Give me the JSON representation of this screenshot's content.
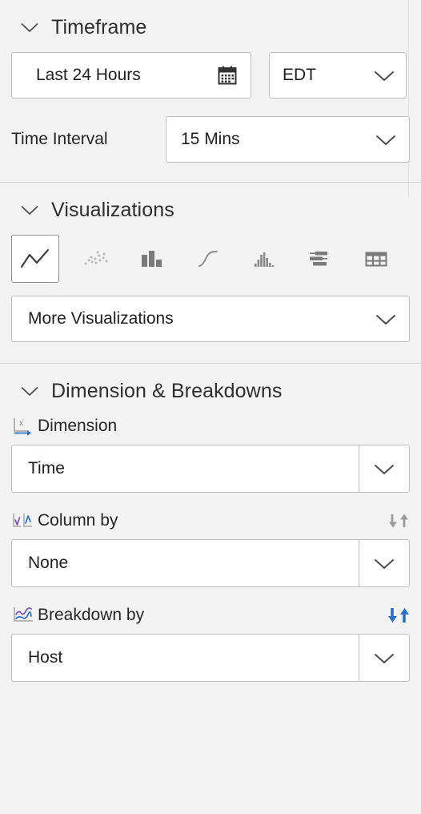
{
  "panel": {
    "accent_blue": "#2c6fc4",
    "accent_purple": "#7a52b3",
    "border_color": "#bdbdbd",
    "background": "#f3f3f3"
  },
  "timeframe": {
    "title": "Timeframe",
    "collapse_icon": "chevron-down-icon",
    "date_range": {
      "value": "Last 24 Hours",
      "icon": "calendar-icon"
    },
    "timezone": {
      "value": "EDT",
      "icon": "chevron-down-icon"
    },
    "time_interval": {
      "label": "Time Interval",
      "value": "15 Mins",
      "icon": "chevron-down-icon"
    }
  },
  "visualizations": {
    "title": "Visualizations",
    "collapse_icon": "chevron-down-icon",
    "selected": "line-chart",
    "options": [
      {
        "id": "line-chart",
        "name": "line-chart-icon",
        "selected": true
      },
      {
        "id": "scatter-plot",
        "name": "scatter-plot-icon",
        "selected": false
      },
      {
        "id": "column-chart",
        "name": "column-chart-icon",
        "selected": false
      },
      {
        "id": "spline-curve",
        "name": "spline-curve-icon",
        "selected": false
      },
      {
        "id": "histogram",
        "name": "histogram-icon",
        "selected": false
      },
      {
        "id": "horizontal-bar-chart",
        "name": "horizontal-bar-chart-icon",
        "selected": false
      },
      {
        "id": "table",
        "name": "table-icon",
        "selected": false
      }
    ],
    "more": {
      "label": "More Visualizations",
      "icon": "chevron-down-icon"
    }
  },
  "dimensions": {
    "title": "Dimension & Breakdowns",
    "collapse_icon": "chevron-down-icon",
    "fields": [
      {
        "label": "Dimension",
        "icon": "x-axis-icon",
        "value": "Time",
        "sort_icon": null,
        "sort_active": false
      },
      {
        "label": "Column by",
        "icon": "small-multiples-icon",
        "value": "None",
        "sort_icon": "sort-arrows-icon",
        "sort_active": false
      },
      {
        "label": "Breakdown by",
        "icon": "series-lines-icon",
        "value": "Host",
        "sort_icon": "sort-arrows-icon",
        "sort_active": true
      }
    ]
  }
}
